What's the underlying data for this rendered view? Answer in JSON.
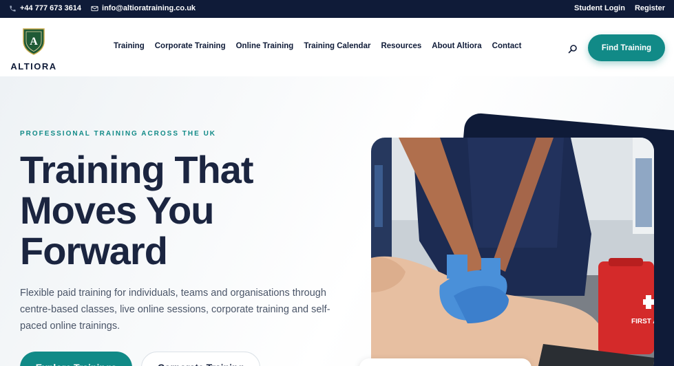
{
  "topbar": {
    "phone": "+44 777 673 3614",
    "email": "info@altioratraining.co.uk",
    "student_login": "Student Login",
    "register": "Register",
    "phone_icon": "phone-icon",
    "email_icon": "envelope-icon"
  },
  "header": {
    "logo_text": "ALTIORA",
    "logo_letter": "A",
    "nav": [
      {
        "label": "Training"
      },
      {
        "label": "Corporate Training"
      },
      {
        "label": "Online Training"
      },
      {
        "label": "Training Calendar"
      },
      {
        "label": "Resources"
      },
      {
        "label": "About Altiora"
      },
      {
        "label": "Contact"
      }
    ],
    "search_icon": "search-icon",
    "cta_label": "Find Training"
  },
  "hero": {
    "eyebrow": "PROFESSIONAL TRAINING ACROSS THE UK",
    "headline": [
      "Training That",
      "Moves You",
      "Forward"
    ],
    "description": "Flexible paid training for individuals, teams and organisations through centre-based classes, live online sessions, corporate training and self-paced online trainings.",
    "primary_button": "Explore Trainings",
    "secondary_button": "Corporate Training",
    "kit_label": "FIRST A"
  },
  "colors": {
    "navy": "#0f1b38",
    "teal": "#118a87",
    "headline": "#1b2540",
    "body_text": "#4a5568",
    "crest_green": "#1f5a36"
  }
}
